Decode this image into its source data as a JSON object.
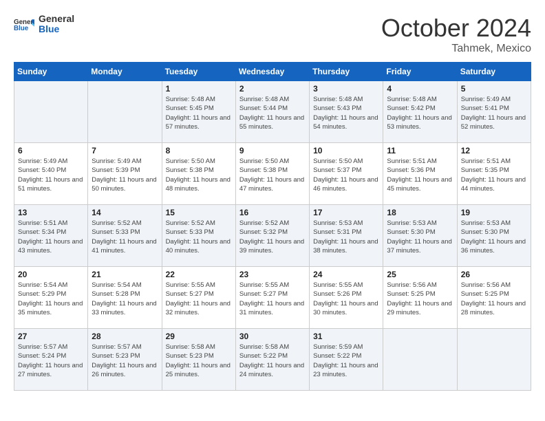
{
  "header": {
    "logo_general": "General",
    "logo_blue": "Blue",
    "month": "October 2024",
    "location": "Tahmek, Mexico"
  },
  "days_of_week": [
    "Sunday",
    "Monday",
    "Tuesday",
    "Wednesday",
    "Thursday",
    "Friday",
    "Saturday"
  ],
  "weeks": [
    [
      {
        "day": "",
        "sunrise": "",
        "sunset": "",
        "daylight": ""
      },
      {
        "day": "",
        "sunrise": "",
        "sunset": "",
        "daylight": ""
      },
      {
        "day": "1",
        "sunrise": "Sunrise: 5:48 AM",
        "sunset": "Sunset: 5:45 PM",
        "daylight": "Daylight: 11 hours and 57 minutes."
      },
      {
        "day": "2",
        "sunrise": "Sunrise: 5:48 AM",
        "sunset": "Sunset: 5:44 PM",
        "daylight": "Daylight: 11 hours and 55 minutes."
      },
      {
        "day": "3",
        "sunrise": "Sunrise: 5:48 AM",
        "sunset": "Sunset: 5:43 PM",
        "daylight": "Daylight: 11 hours and 54 minutes."
      },
      {
        "day": "4",
        "sunrise": "Sunrise: 5:48 AM",
        "sunset": "Sunset: 5:42 PM",
        "daylight": "Daylight: 11 hours and 53 minutes."
      },
      {
        "day": "5",
        "sunrise": "Sunrise: 5:49 AM",
        "sunset": "Sunset: 5:41 PM",
        "daylight": "Daylight: 11 hours and 52 minutes."
      }
    ],
    [
      {
        "day": "6",
        "sunrise": "Sunrise: 5:49 AM",
        "sunset": "Sunset: 5:40 PM",
        "daylight": "Daylight: 11 hours and 51 minutes."
      },
      {
        "day": "7",
        "sunrise": "Sunrise: 5:49 AM",
        "sunset": "Sunset: 5:39 PM",
        "daylight": "Daylight: 11 hours and 50 minutes."
      },
      {
        "day": "8",
        "sunrise": "Sunrise: 5:50 AM",
        "sunset": "Sunset: 5:38 PM",
        "daylight": "Daylight: 11 hours and 48 minutes."
      },
      {
        "day": "9",
        "sunrise": "Sunrise: 5:50 AM",
        "sunset": "Sunset: 5:38 PM",
        "daylight": "Daylight: 11 hours and 47 minutes."
      },
      {
        "day": "10",
        "sunrise": "Sunrise: 5:50 AM",
        "sunset": "Sunset: 5:37 PM",
        "daylight": "Daylight: 11 hours and 46 minutes."
      },
      {
        "day": "11",
        "sunrise": "Sunrise: 5:51 AM",
        "sunset": "Sunset: 5:36 PM",
        "daylight": "Daylight: 11 hours and 45 minutes."
      },
      {
        "day": "12",
        "sunrise": "Sunrise: 5:51 AM",
        "sunset": "Sunset: 5:35 PM",
        "daylight": "Daylight: 11 hours and 44 minutes."
      }
    ],
    [
      {
        "day": "13",
        "sunrise": "Sunrise: 5:51 AM",
        "sunset": "Sunset: 5:34 PM",
        "daylight": "Daylight: 11 hours and 43 minutes."
      },
      {
        "day": "14",
        "sunrise": "Sunrise: 5:52 AM",
        "sunset": "Sunset: 5:33 PM",
        "daylight": "Daylight: 11 hours and 41 minutes."
      },
      {
        "day": "15",
        "sunrise": "Sunrise: 5:52 AM",
        "sunset": "Sunset: 5:33 PM",
        "daylight": "Daylight: 11 hours and 40 minutes."
      },
      {
        "day": "16",
        "sunrise": "Sunrise: 5:52 AM",
        "sunset": "Sunset: 5:32 PM",
        "daylight": "Daylight: 11 hours and 39 minutes."
      },
      {
        "day": "17",
        "sunrise": "Sunrise: 5:53 AM",
        "sunset": "Sunset: 5:31 PM",
        "daylight": "Daylight: 11 hours and 38 minutes."
      },
      {
        "day": "18",
        "sunrise": "Sunrise: 5:53 AM",
        "sunset": "Sunset: 5:30 PM",
        "daylight": "Daylight: 11 hours and 37 minutes."
      },
      {
        "day": "19",
        "sunrise": "Sunrise: 5:53 AM",
        "sunset": "Sunset: 5:30 PM",
        "daylight": "Daylight: 11 hours and 36 minutes."
      }
    ],
    [
      {
        "day": "20",
        "sunrise": "Sunrise: 5:54 AM",
        "sunset": "Sunset: 5:29 PM",
        "daylight": "Daylight: 11 hours and 35 minutes."
      },
      {
        "day": "21",
        "sunrise": "Sunrise: 5:54 AM",
        "sunset": "Sunset: 5:28 PM",
        "daylight": "Daylight: 11 hours and 33 minutes."
      },
      {
        "day": "22",
        "sunrise": "Sunrise: 5:55 AM",
        "sunset": "Sunset: 5:27 PM",
        "daylight": "Daylight: 11 hours and 32 minutes."
      },
      {
        "day": "23",
        "sunrise": "Sunrise: 5:55 AM",
        "sunset": "Sunset: 5:27 PM",
        "daylight": "Daylight: 11 hours and 31 minutes."
      },
      {
        "day": "24",
        "sunrise": "Sunrise: 5:55 AM",
        "sunset": "Sunset: 5:26 PM",
        "daylight": "Daylight: 11 hours and 30 minutes."
      },
      {
        "day": "25",
        "sunrise": "Sunrise: 5:56 AM",
        "sunset": "Sunset: 5:25 PM",
        "daylight": "Daylight: 11 hours and 29 minutes."
      },
      {
        "day": "26",
        "sunrise": "Sunrise: 5:56 AM",
        "sunset": "Sunset: 5:25 PM",
        "daylight": "Daylight: 11 hours and 28 minutes."
      }
    ],
    [
      {
        "day": "27",
        "sunrise": "Sunrise: 5:57 AM",
        "sunset": "Sunset: 5:24 PM",
        "daylight": "Daylight: 11 hours and 27 minutes."
      },
      {
        "day": "28",
        "sunrise": "Sunrise: 5:57 AM",
        "sunset": "Sunset: 5:23 PM",
        "daylight": "Daylight: 11 hours and 26 minutes."
      },
      {
        "day": "29",
        "sunrise": "Sunrise: 5:58 AM",
        "sunset": "Sunset: 5:23 PM",
        "daylight": "Daylight: 11 hours and 25 minutes."
      },
      {
        "day": "30",
        "sunrise": "Sunrise: 5:58 AM",
        "sunset": "Sunset: 5:22 PM",
        "daylight": "Daylight: 11 hours and 24 minutes."
      },
      {
        "day": "31",
        "sunrise": "Sunrise: 5:59 AM",
        "sunset": "Sunset: 5:22 PM",
        "daylight": "Daylight: 11 hours and 23 minutes."
      },
      {
        "day": "",
        "sunrise": "",
        "sunset": "",
        "daylight": ""
      },
      {
        "day": "",
        "sunrise": "",
        "sunset": "",
        "daylight": ""
      }
    ]
  ]
}
